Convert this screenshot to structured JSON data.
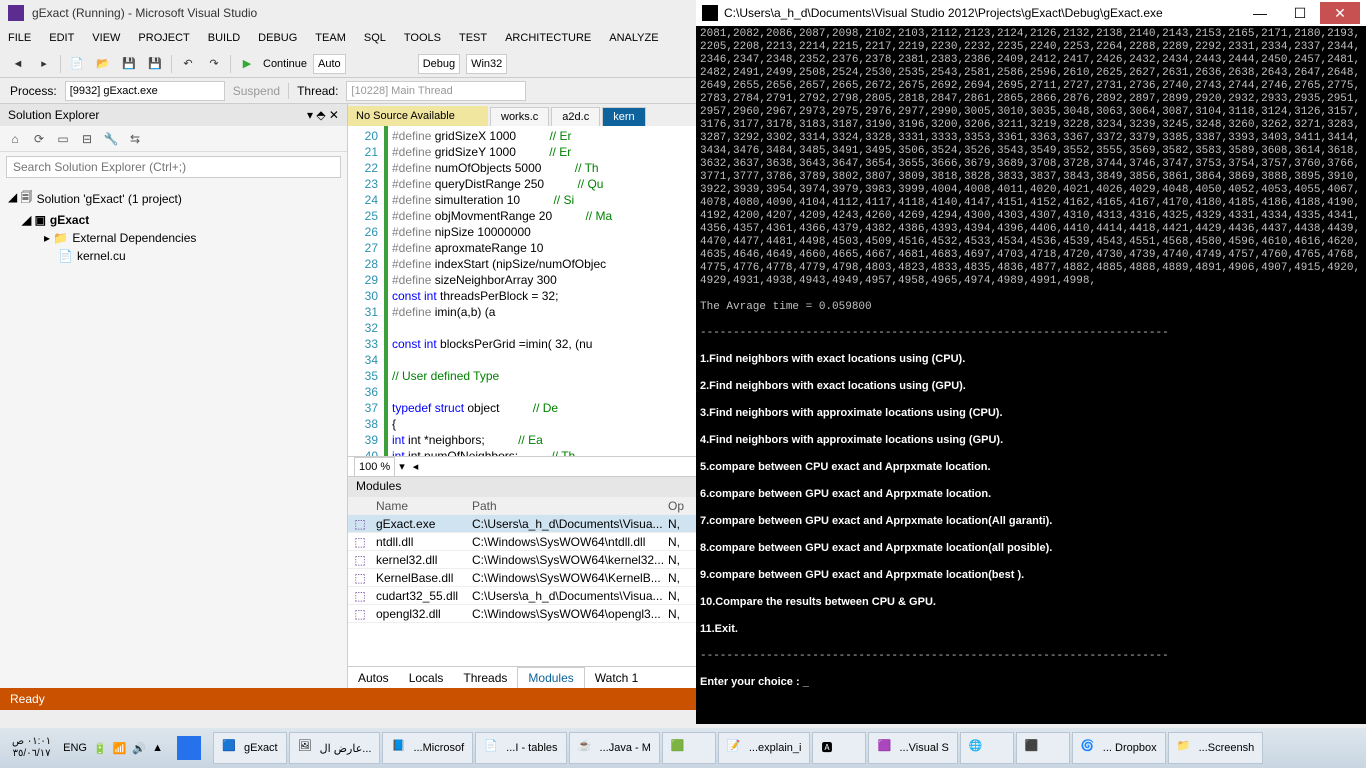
{
  "vs": {
    "title": "gExact (Running) - Microsoft Visual Studio",
    "menu": [
      "FILE",
      "EDIT",
      "VIEW",
      "PROJECT",
      "BUILD",
      "DEBUG",
      "TEAM",
      "SQL",
      "TOOLS",
      "TEST",
      "ARCHITECTURE",
      "ANALYZE"
    ],
    "continue_label": "Continue",
    "combo_auto": "Auto",
    "combo_debug": "Debug",
    "combo_platform": "Win32",
    "process_label": "Process:",
    "process_value": "[9932] gExact.exe",
    "suspend": "Suspend",
    "thread_label": "Thread:",
    "thread_value": "[10228] Main Thread",
    "sol_title": "Solution Explorer",
    "sol_search_ph": "Search Solution Explorer (Ctrl+;)",
    "tree": {
      "sol": "Solution 'gExact' (1 project)",
      "proj": "gExact",
      "ext": "External Dependencies",
      "file": "kernel.cu"
    },
    "ed_warn": "No Source Available",
    "tabs": [
      "works.c",
      "a2d.c",
      "kern"
    ],
    "code_start": 20,
    "code_lines": [
      {
        "t": "#define gridSizeX 1000",
        "c": "// Er"
      },
      {
        "t": "#define gridSizeY 1000",
        "c": "// Er"
      },
      {
        "t": "#define numOfObjects 5000",
        "c": "// Th"
      },
      {
        "t": "#define queryDistRange 250",
        "c": "// Qu"
      },
      {
        "t": "#define simuIteration 10",
        "c": "// Si"
      },
      {
        "t": "#define objMovmentRange 20",
        "c": "// Ma"
      },
      {
        "t": "#define nipSize 10000000",
        "c": ""
      },
      {
        "t": "#define aproxmateRange 10",
        "c": ""
      },
      {
        "t": "#define indexStart (nipSize/numOfObjec",
        "c": ""
      },
      {
        "t": "#define sizeNeighborArray 300",
        "c": ""
      },
      {
        "t": "const int threadsPerBlock = 32;",
        "c": "",
        "kw": "const int"
      },
      {
        "t": "#define imin(a,b) (a<b?a:b)",
        "c": ""
      },
      {
        "t": "",
        "c": ""
      },
      {
        "t": "const int blocksPerGrid =imin( 32, (nu",
        "c": "",
        "kw": "const int"
      },
      {
        "t": "",
        "c": ""
      },
      {
        "t": "// User defined Type",
        "c": "",
        "allcmt": true
      },
      {
        "t": "",
        "c": ""
      },
      {
        "t": "typedef struct object",
        "c": "// De",
        "kw": "typedef struct"
      },
      {
        "t": "{",
        "c": ""
      },
      {
        "t": "    int *neighbors;",
        "c": "// Ea",
        "kw": "int"
      },
      {
        "t": "    int numOfNeighbors;",
        "c": "// Th",
        "kw": "int"
      },
      {
        "t": "} ;",
        "c": ""
      }
    ],
    "zoom": "100 %",
    "modules_title": "Modules",
    "mod_hdr": {
      "name": "Name",
      "path": "Path",
      "opt": "Op"
    },
    "modules": [
      {
        "name": "gExact.exe",
        "path": "C:\\Users\\a_h_d\\Documents\\Visua...",
        "opt": "N,"
      },
      {
        "name": "ntdll.dll",
        "path": "C:\\Windows\\SysWOW64\\ntdll.dll",
        "opt": "N,"
      },
      {
        "name": "kernel32.dll",
        "path": "C:\\Windows\\SysWOW64\\kernel32...",
        "opt": "N,"
      },
      {
        "name": "KernelBase.dll",
        "path": "C:\\Windows\\SysWOW64\\KernelB...",
        "opt": "N,"
      },
      {
        "name": "cudart32_55.dll",
        "path": "C:\\Users\\a_h_d\\Documents\\Visua...",
        "opt": "N,"
      },
      {
        "name": "opengl32.dll",
        "path": "C:\\Windows\\SysWOW64\\opengl3...",
        "opt": "N,"
      }
    ],
    "bottom_tabs": [
      "Autos",
      "Locals",
      "Threads",
      "Modules",
      "Watch 1"
    ],
    "status": "Ready"
  },
  "console": {
    "title": "C:\\Users\\a_h_d\\Documents\\Visual Studio 2012\\Projects\\gExact\\Debug\\gExact.exe",
    "numbers": "2081,2082,2086,2087,2098,2102,2103,2112,2123,2124,2126,2132,2138,2140,2143,2153,2165,2171,2180,2193,2205,2208,2213,2214,2215,2217,2219,2230,2232,2235,2240,2253,2264,2288,2289,2292,2331,2334,2337,2344,2346,2347,2348,2352,2376,2378,2381,2383,2386,2409,2412,2417,2426,2432,2434,2443,2444,2450,2457,2481,2482,2491,2499,2508,2524,2530,2535,2543,2581,2586,2596,2610,2625,2627,2631,2636,2638,2643,2647,2648,2649,2655,2656,2657,2665,2672,2675,2692,2694,2695,2711,2727,2731,2736,2740,2743,2744,2746,2765,2775,2783,2784,2791,2792,2798,2805,2818,2847,2861,2865,2866,2876,2892,2897,2899,2920,2932,2933,2935,2951,2957,2960,2967,2973,2975,2976,2977,2990,3005,3010,3035,3048,3063,3064,3087,3104,3118,3124,3126,3157,3176,3177,3178,3183,3187,3190,3196,3200,3206,3211,3219,3228,3234,3239,3245,3248,3260,3262,3271,3283,3287,3292,3302,3314,3324,3328,3331,3333,3353,3361,3363,3367,3372,3379,3385,3387,3393,3403,3411,3414,3434,3476,3484,3485,3491,3495,3506,3524,3526,3543,3549,3552,3555,3569,3582,3583,3589,3608,3614,3618,3632,3637,3638,3643,3647,3654,3655,3666,3679,3689,3708,3728,3744,3746,3747,3753,3754,3757,3760,3766,3771,3777,3786,3789,3802,3807,3809,3818,3828,3833,3837,3843,3849,3856,3861,3864,3869,3888,3895,3910,3922,3939,3954,3974,3979,3983,3999,4004,4008,4011,4020,4021,4026,4029,4048,4050,4052,4053,4055,4067,4078,4080,4090,4104,4112,4117,4118,4140,4147,4151,4152,4162,4165,4167,4170,4180,4185,4186,4188,4190,4192,4200,4207,4209,4243,4260,4269,4294,4300,4303,4307,4310,4313,4316,4325,4329,4331,4334,4335,4341,4356,4357,4361,4366,4379,4382,4386,4393,4394,4396,4406,4410,4414,4418,4421,4429,4436,4437,4438,4439,4470,4477,4481,4498,4503,4509,4516,4532,4533,4534,4536,4539,4543,4551,4568,4580,4596,4610,4616,4620,4635,4646,4649,4660,4665,4667,4681,4683,4697,4703,4718,4720,4730,4739,4740,4749,4757,4760,4765,4768,4775,4776,4778,4779,4798,4803,4823,4833,4835,4836,4877,4882,4885,4888,4889,4891,4906,4907,4915,4920,4929,4931,4938,4943,4949,4957,4958,4965,4974,4989,4991,4998,",
    "avg": "The Avrage time = 0.059800",
    "sep": "-----------------------------------------------------------------------",
    "menu": [
      "1.Find neighbors with exact locations using (CPU).",
      "2.Find neighbors with exact locations using (GPU).",
      "3.Find neighbors with approximate locations using (CPU).",
      "4.Find neighbors with approximate locations using (GPU).",
      "5.compare between CPU exact and Aprpxmate location.",
      "6.compare between GPU exact and Aprpxmate location.",
      "7.compare between GPU exact and Aprpxmate location(All garanti).",
      "8.compare between GPU exact and Aprpxmate location(all posible).",
      "9.compare between GPU exact and Aprpxmate location(best ).",
      "10.Compare the results between CPU & GPU.",
      "11.Exit."
    ],
    "prompt": "Enter your choice : _"
  },
  "taskbar": {
    "clock_time": "٠١:٠١ ص",
    "clock_date": "٣٥/٠٦/١٧",
    "lang": "ENG",
    "tasks": [
      "gExact",
      "عارض ال...",
      "...Microsof",
      "...I - tables",
      "...Java - M",
      "",
      "...explain_i",
      "",
      "...Visual S",
      "",
      "",
      "... Dropbox",
      "...Screensh"
    ]
  }
}
